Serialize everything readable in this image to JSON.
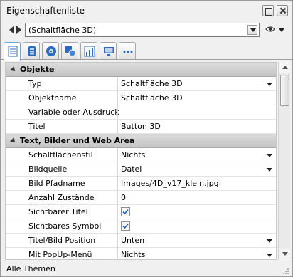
{
  "window": {
    "title": "Eigenschaftenliste"
  },
  "navigation": {
    "object_selector": "(Schaltfläche 3D)"
  },
  "tabs": [
    {
      "icon": "list-icon",
      "active": true
    },
    {
      "icon": "database-icon",
      "active": false
    },
    {
      "icon": "palette-icon",
      "active": false
    },
    {
      "icon": "shapes-icon",
      "active": false
    },
    {
      "icon": "chart-icon",
      "active": false
    },
    {
      "icon": "monitor-icon",
      "active": false
    },
    {
      "icon": "more-icon",
      "active": false
    }
  ],
  "sections": {
    "objekte": "Objekte",
    "text": "Text, Bilder und Web Area"
  },
  "properties": {
    "typ": {
      "label": "Typ",
      "value": "Schaltfläche 3D"
    },
    "objektname": {
      "label": "Objektname",
      "value": "Schaltfläche 3D"
    },
    "variable": {
      "label": "Variable oder Ausdruck",
      "value": ""
    },
    "titel": {
      "label": "Titel",
      "value": "Button 3D"
    },
    "schaltflaechenstil": {
      "label": "Schaltflächenstil",
      "value": "Nichts"
    },
    "bildquelle": {
      "label": "Bildquelle",
      "value": "Datei"
    },
    "bild_pfadname": {
      "label": "Bild Pfadname",
      "value": "Images/4D_v17_klein.jpg"
    },
    "anzahl_zustaende": {
      "label": "Anzahl Zustände",
      "value": "0"
    },
    "sichtbarer_titel": {
      "label": "Sichtbarer Titel",
      "checked": true
    },
    "sichtbares_symbol": {
      "label": "Sichtbares Symbol",
      "checked": true
    },
    "titel_bild_position": {
      "label": "Titel/Bild Position",
      "value": "Unten"
    },
    "popup_menue": {
      "label": "Mit PopUp-Menü",
      "value": "Nichts"
    }
  },
  "status": {
    "themes_label": "Alle Themen"
  },
  "colors": {
    "section_header": "#c9c9c9",
    "accent_blue": "#1f5fb4"
  }
}
